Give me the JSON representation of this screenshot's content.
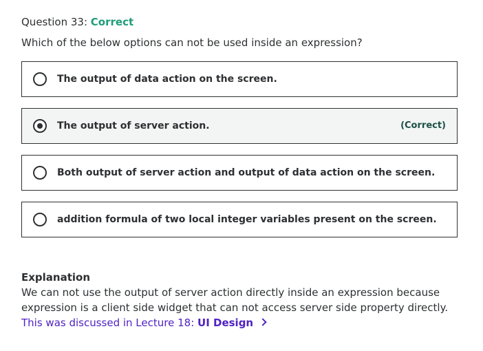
{
  "question": {
    "label": "Question 33:",
    "status": "Correct",
    "text": "Which of the below options can not be used inside an expression?"
  },
  "options": [
    {
      "label": "The output of data action on the screen.",
      "selected": false,
      "badge": ""
    },
    {
      "label": "The output of server action.",
      "selected": true,
      "badge": "(Correct)"
    },
    {
      "label": "Both output of server action and output of data action on the screen.",
      "selected": false,
      "badge": ""
    },
    {
      "label": "addition formula of two local integer variables present on the screen.",
      "selected": false,
      "badge": ""
    }
  ],
  "explanation": {
    "title": "Explanation",
    "line1": "We can not use the output of server action directly inside an expression because",
    "line2": "expression is a client side widget that can not access server side property directly.",
    "link_prefix": "This was discussed in Lecture 18: ",
    "link_name": "UI Design"
  },
  "colors": {
    "correct_green": "#1e9c7a",
    "link_purple": "#5022c3",
    "selected_bg": "#f2f5f4"
  },
  "icons": {
    "radio": "radio-button-icon",
    "link_arrow": "chevron-right-icon"
  }
}
